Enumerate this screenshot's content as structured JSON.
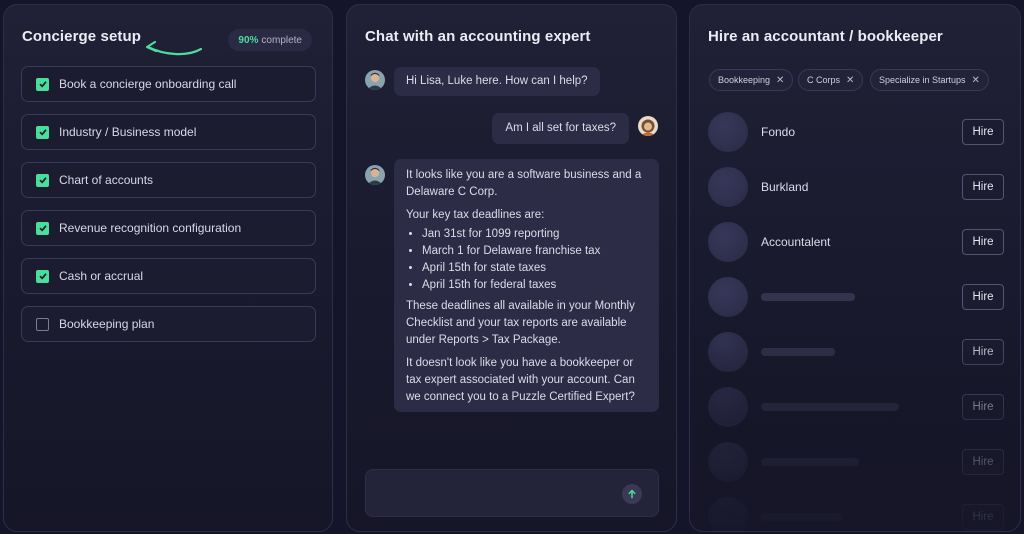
{
  "concierge": {
    "title": "Concierge setup",
    "progress_pct": "90%",
    "progress_label": "complete",
    "items": [
      {
        "label": "Book a concierge onboarding call",
        "checked": true
      },
      {
        "label": "Industry / Business model",
        "checked": true
      },
      {
        "label": "Chart of accounts",
        "checked": true
      },
      {
        "label": "Revenue recognition configuration",
        "checked": true
      },
      {
        "label": "Cash or accrual",
        "checked": true
      },
      {
        "label": "Bookkeeping plan",
        "checked": false
      }
    ]
  },
  "chat": {
    "title": "Chat with an accounting expert",
    "msg1": "Hi Lisa, Luke here. How can I help?",
    "msg2": "Am I all set for taxes?",
    "msg3": {
      "p1": "It looks like you are a software business and a Delaware C Corp.",
      "p2": "Your key tax deadlines are:",
      "deadlines": [
        "Jan 31st for 1099 reporting",
        "March 1 for Delaware franchise tax",
        "April 15th for state taxes",
        "April 15th for federal taxes"
      ],
      "p3": "These deadlines all available in your Monthly Checklist and your tax reports are available under Reports > Tax Package.",
      "p4": "It doesn't look like you have a bookkeeper or tax expert associated with your account. Can we connect you to a Puzzle Certified Expert?"
    }
  },
  "hire": {
    "title": "Hire an accountant / bookkeeper",
    "filters": [
      "Bookkeeping",
      "C Corps",
      "Specialize in Startups"
    ],
    "hire_label": "Hire",
    "accountants": [
      "Fondo",
      "Burkland",
      "Accountalent"
    ]
  },
  "colors": {
    "accent": "#4ade9a",
    "background": "#14142a"
  }
}
